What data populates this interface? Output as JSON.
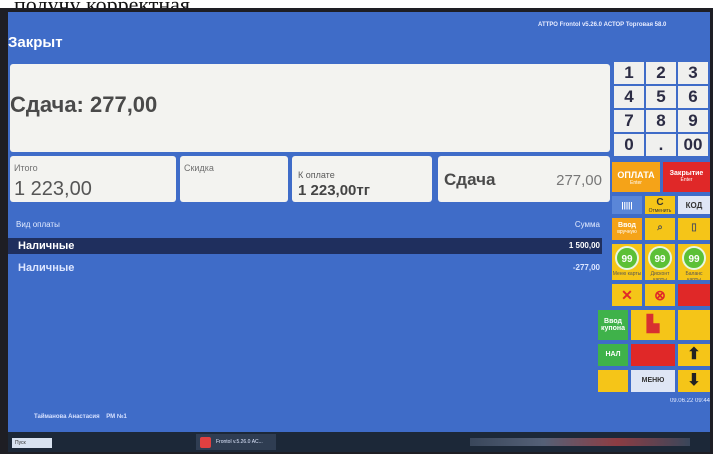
{
  "caption": "получу корректная.",
  "status": {
    "title": "Закрыт"
  },
  "app_version": "АТТРО Frontol v5.26.0 АСТОР Торговая 58.0",
  "change_banner": "Сдача: 277,00",
  "tiles": {
    "total": {
      "label": "Итого",
      "value": "1 223,00"
    },
    "discount": {
      "label": "Скидка",
      "value": ""
    },
    "to_pay": {
      "label": "К оплате",
      "value": "1 223,00тг"
    },
    "change": {
      "label": "Сдача",
      "value": "277,00"
    }
  },
  "payments": {
    "headers": {
      "method": "Вид оплаты",
      "amount": "Сумма"
    },
    "rows": [
      {
        "method": "Наличные",
        "amount": "1 500,00"
      },
      {
        "method": "Наличные",
        "amount": "-277,00"
      }
    ]
  },
  "keypad": {
    "keys": [
      "1",
      "2",
      "3",
      "4",
      "5",
      "6",
      "7",
      "8",
      "9",
      "0",
      ".",
      "00"
    ]
  },
  "function_buttons": {
    "oplata": {
      "label": "ОПЛАТА",
      "sub": "Enter"
    },
    "close": {
      "label": "Закрытие",
      "sub": "Enter"
    },
    "barcode": {
      "label": "|||||"
    },
    "c": {
      "label": "С",
      "sub": "Отменить"
    },
    "kod": {
      "label": "КОД"
    },
    "vvod": {
      "label": "Ввод",
      "sub": "вручную"
    },
    "check_label": "Ввод купона",
    "nal_label": "НАЛ",
    "menu_label": "МЕНЮ",
    "kart": "Меню карты",
    "disc_card": "Дисконт карты",
    "card_balance": "Баланс карты",
    "print": "Печать"
  },
  "footer": {
    "cashier": "Тайманова Анастасия",
    "workstation": "РМ №1",
    "time": "09.06.22 09:44"
  },
  "taskbar": {
    "start": "Пуск",
    "app": "Frontol v.5.26.0 АС..."
  },
  "colors": {
    "background": "#3f6cc8",
    "selected_row": "#1f2f5e",
    "oplata": "#f5a318",
    "close": "#e02828",
    "green": "#5cc036"
  }
}
